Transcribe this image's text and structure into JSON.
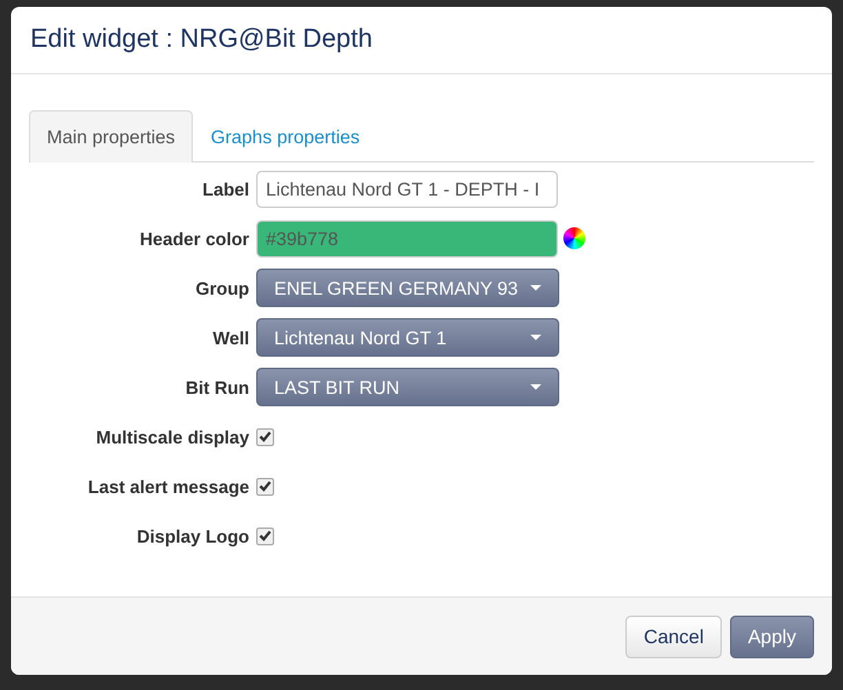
{
  "dialog": {
    "title": "Edit widget : NRG@Bit Depth"
  },
  "tabs": [
    {
      "label": "Main properties",
      "selected": true
    },
    {
      "label": "Graphs properties",
      "selected": false
    }
  ],
  "fields": [
    {
      "kind": "text",
      "label": "Label",
      "value": "Lichtenau Nord GT 1 - DEPTH - I"
    },
    {
      "kind": "color",
      "label": "Header color",
      "value": "#39b778",
      "color": "#39b778"
    },
    {
      "kind": "select",
      "label": "Group",
      "value": "ENEL GREEN GERMANY 93"
    },
    {
      "kind": "select",
      "label": "Well",
      "value": "Lichtenau Nord GT 1"
    },
    {
      "kind": "select",
      "label": "Bit Run",
      "value": "LAST BIT RUN"
    },
    {
      "kind": "checkbox",
      "label": "Multiscale display",
      "checked": true
    },
    {
      "kind": "checkbox",
      "label": "Last alert message",
      "checked": true
    },
    {
      "kind": "checkbox",
      "label": "Display Logo",
      "checked": true
    }
  ],
  "buttons": [
    {
      "label": "Cancel",
      "kind": "default"
    },
    {
      "label": "Apply",
      "kind": "primary"
    }
  ]
}
